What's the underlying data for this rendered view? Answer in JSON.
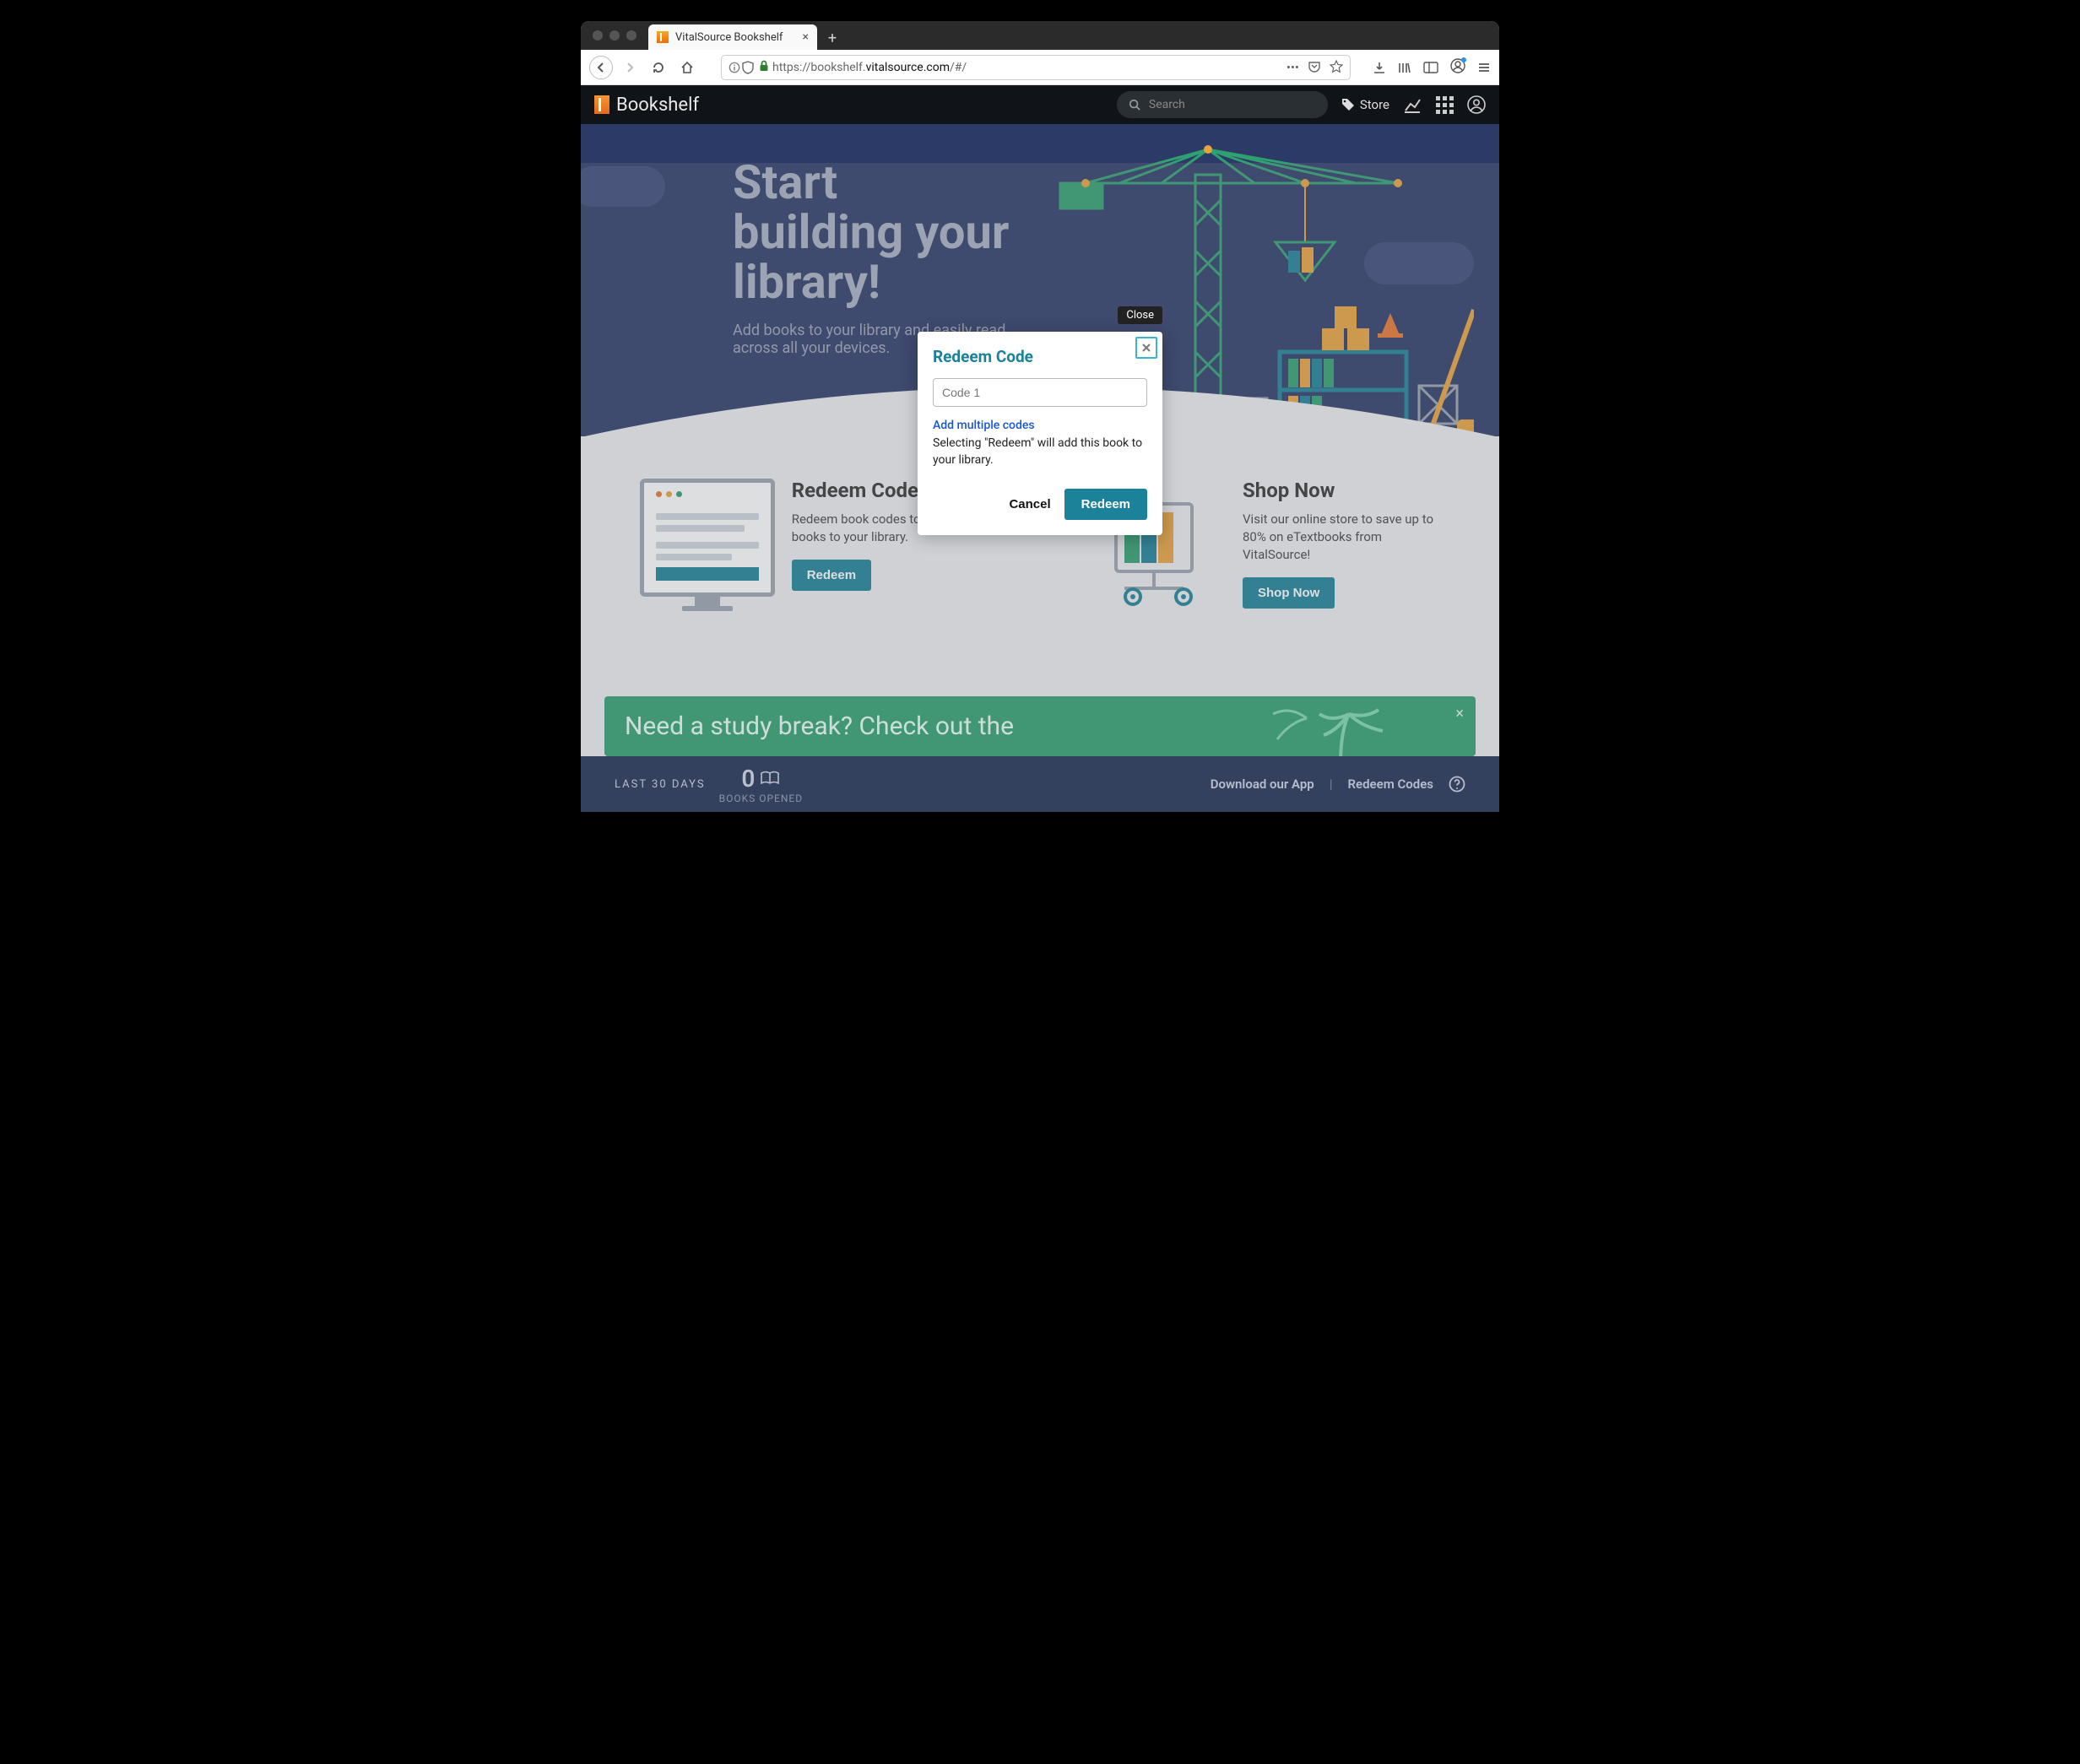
{
  "browser": {
    "tab_title": "VitalSource Bookshelf",
    "url_prefix": "https://bookshelf.",
    "url_domain": "vitalsource.com",
    "url_path": "/#/"
  },
  "app": {
    "brand": "Bookshelf",
    "search_placeholder": "Search",
    "store_label": "Store"
  },
  "hero": {
    "title": "Start\nbuilding your\nlibrary!",
    "subtitle": "Add books to your library and easily read across all your devices."
  },
  "cards": {
    "redeem": {
      "title": "Redeem Codes",
      "body": "Redeem book codes to instantly add books to your library.",
      "button": "Redeem"
    },
    "shop": {
      "title": "Shop Now",
      "body": "Visit our online store to save up to 80% on eTextbooks from VitalSource!",
      "button": "Shop Now"
    }
  },
  "banner": {
    "text": "Need a study break? Check out the"
  },
  "footer": {
    "label": "LAST 30 DAYS",
    "count": "0",
    "count_label": "BOOKS OPENED",
    "download": "Download our App",
    "redeem": "Redeem Codes"
  },
  "dialog": {
    "close_tooltip": "Close",
    "title": "Redeem Code",
    "input_placeholder": "Code 1",
    "multi_link": "Add multiple codes",
    "description": "Selecting \"Redeem\" will add this book to your library.",
    "cancel": "Cancel",
    "submit": "Redeem"
  }
}
